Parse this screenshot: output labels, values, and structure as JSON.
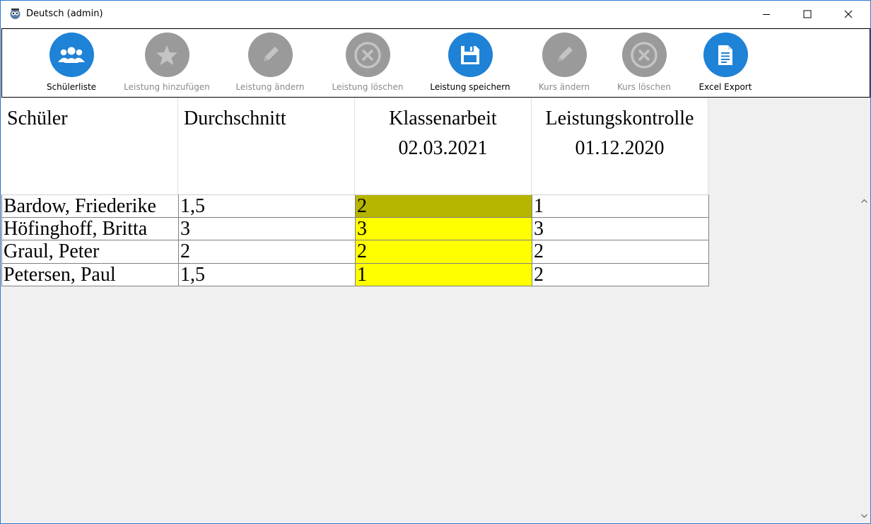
{
  "window": {
    "title": "Deutsch (admin)"
  },
  "toolbar": {
    "items": [
      {
        "label": "Schülerliste",
        "icon": "users-icon",
        "enabled": true
      },
      {
        "label": "Leistung hinzufügen",
        "icon": "star-icon",
        "enabled": false
      },
      {
        "label": "Leistung ändern",
        "icon": "pencil-icon",
        "enabled": false
      },
      {
        "label": "Leistung löschen",
        "icon": "delete-circle-icon",
        "enabled": false
      },
      {
        "label": "Leistung speichern",
        "icon": "save-icon",
        "enabled": true
      },
      {
        "label": "Kurs ändern",
        "icon": "pencil-icon",
        "enabled": false
      },
      {
        "label": "Kurs löschen",
        "icon": "delete-circle-icon",
        "enabled": false
      },
      {
        "label": "Excel Export",
        "icon": "document-icon",
        "enabled": true
      }
    ]
  },
  "grid": {
    "columns": [
      {
        "line1": "Schüler",
        "line2": ""
      },
      {
        "line1": "Durchschnitt",
        "line2": ""
      },
      {
        "line1": "Klassenarbeit",
        "line2": "02.03.2021"
      },
      {
        "line1": "Leistungskontrolle",
        "line2": "01.12.2020"
      }
    ],
    "rows": [
      {
        "name": "Bardow, Friederike",
        "avg": "1,5",
        "klassenarbeit": "2",
        "leistungskontrolle": "1"
      },
      {
        "name": "Höfinghoff, Britta",
        "avg": "3",
        "klassenarbeit": "3",
        "leistungskontrolle": "3"
      },
      {
        "name": "Graul, Peter",
        "avg": "2",
        "klassenarbeit": "2",
        "leistungskontrolle": "2"
      },
      {
        "name": "Petersen, Paul",
        "avg": "1,5",
        "klassenarbeit": "1",
        "leistungskontrolle": "2"
      }
    ]
  },
  "colors": {
    "accent": "#1e82d6",
    "disabled": "#9a9a9a",
    "highlight_column": "#ffff00",
    "selected_cell": "#b5b500"
  }
}
